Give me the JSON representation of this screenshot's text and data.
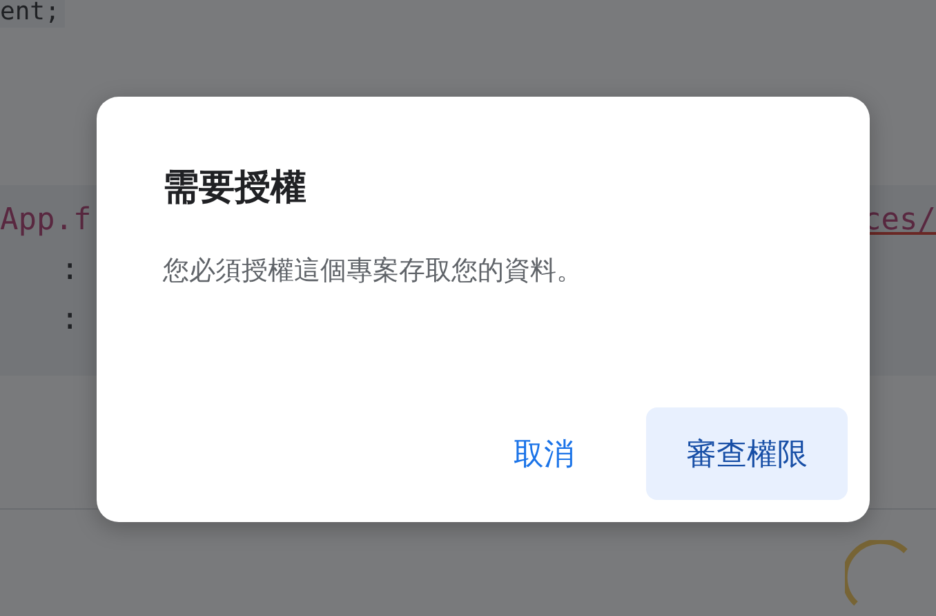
{
  "background": {
    "top_code": "ent;",
    "code_left": "App.f",
    "code_right": "ces/",
    "code_lines": [
      ":",
      ":"
    ],
    "loading": true
  },
  "dialog": {
    "title": "需要授權",
    "message": "您必須授權這個專案存取您的資料。",
    "buttons": [
      {
        "label": "取消",
        "kind": "text"
      },
      {
        "label": "審查權限",
        "kind": "tonal"
      }
    ]
  }
}
